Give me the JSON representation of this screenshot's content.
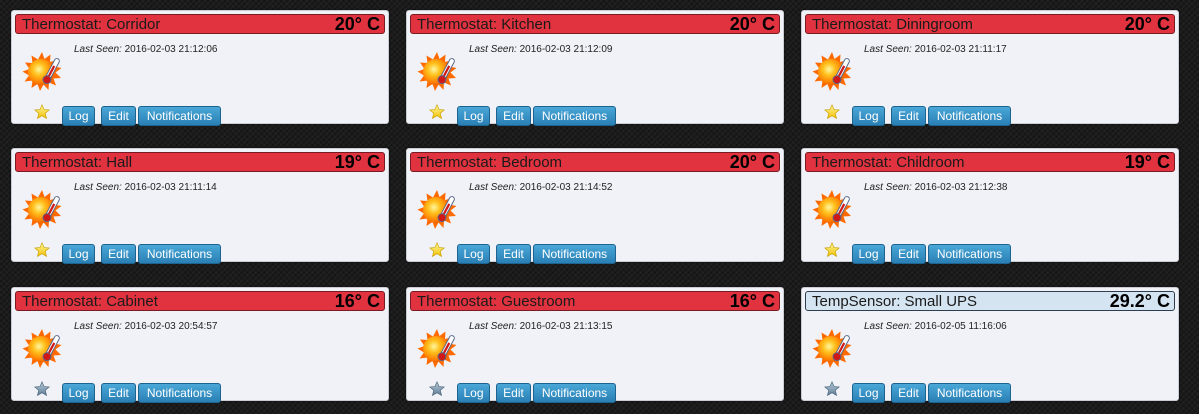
{
  "lastseen_label": "Last Seen:",
  "buttons": {
    "log": "Log",
    "edit": "Edit",
    "notifications": "Notifications"
  },
  "colors": {
    "thermostat_header": "#e1333f",
    "sensor_header": "#d5e4f1",
    "button": "#2a7fb4"
  },
  "devices": [
    {
      "title": "Thermostat: Corridor",
      "temp": "20° C",
      "last_seen": "2016-02-03 21:12:06",
      "favorite": true,
      "type": "thermostat"
    },
    {
      "title": "Thermostat: Kitchen",
      "temp": "20° C",
      "last_seen": "2016-02-03 21:12:09",
      "favorite": true,
      "type": "thermostat"
    },
    {
      "title": "Thermostat: Diningroom",
      "temp": "20° C",
      "last_seen": "2016-02-03 21:11:17",
      "favorite": true,
      "type": "thermostat"
    },
    {
      "title": "Thermostat: Hall",
      "temp": "19° C",
      "last_seen": "2016-02-03 21:11:14",
      "favorite": true,
      "type": "thermostat"
    },
    {
      "title": "Thermostat: Bedroom",
      "temp": "20° C",
      "last_seen": "2016-02-03 21:14:52",
      "favorite": true,
      "type": "thermostat"
    },
    {
      "title": "Thermostat: Childroom",
      "temp": "19° C",
      "last_seen": "2016-02-03 21:12:38",
      "favorite": true,
      "type": "thermostat"
    },
    {
      "title": "Thermostat: Cabinet",
      "temp": "16° C",
      "last_seen": "2016-02-03 20:54:57",
      "favorite": false,
      "type": "thermostat"
    },
    {
      "title": "Thermostat: Guestroom",
      "temp": "16° C",
      "last_seen": "2016-02-03 21:13:15",
      "favorite": false,
      "type": "thermostat"
    },
    {
      "title": "TempSensor: Small UPS",
      "temp": "29.2° C",
      "last_seen": "2016-02-05 11:16:06",
      "favorite": false,
      "type": "sensor"
    }
  ]
}
